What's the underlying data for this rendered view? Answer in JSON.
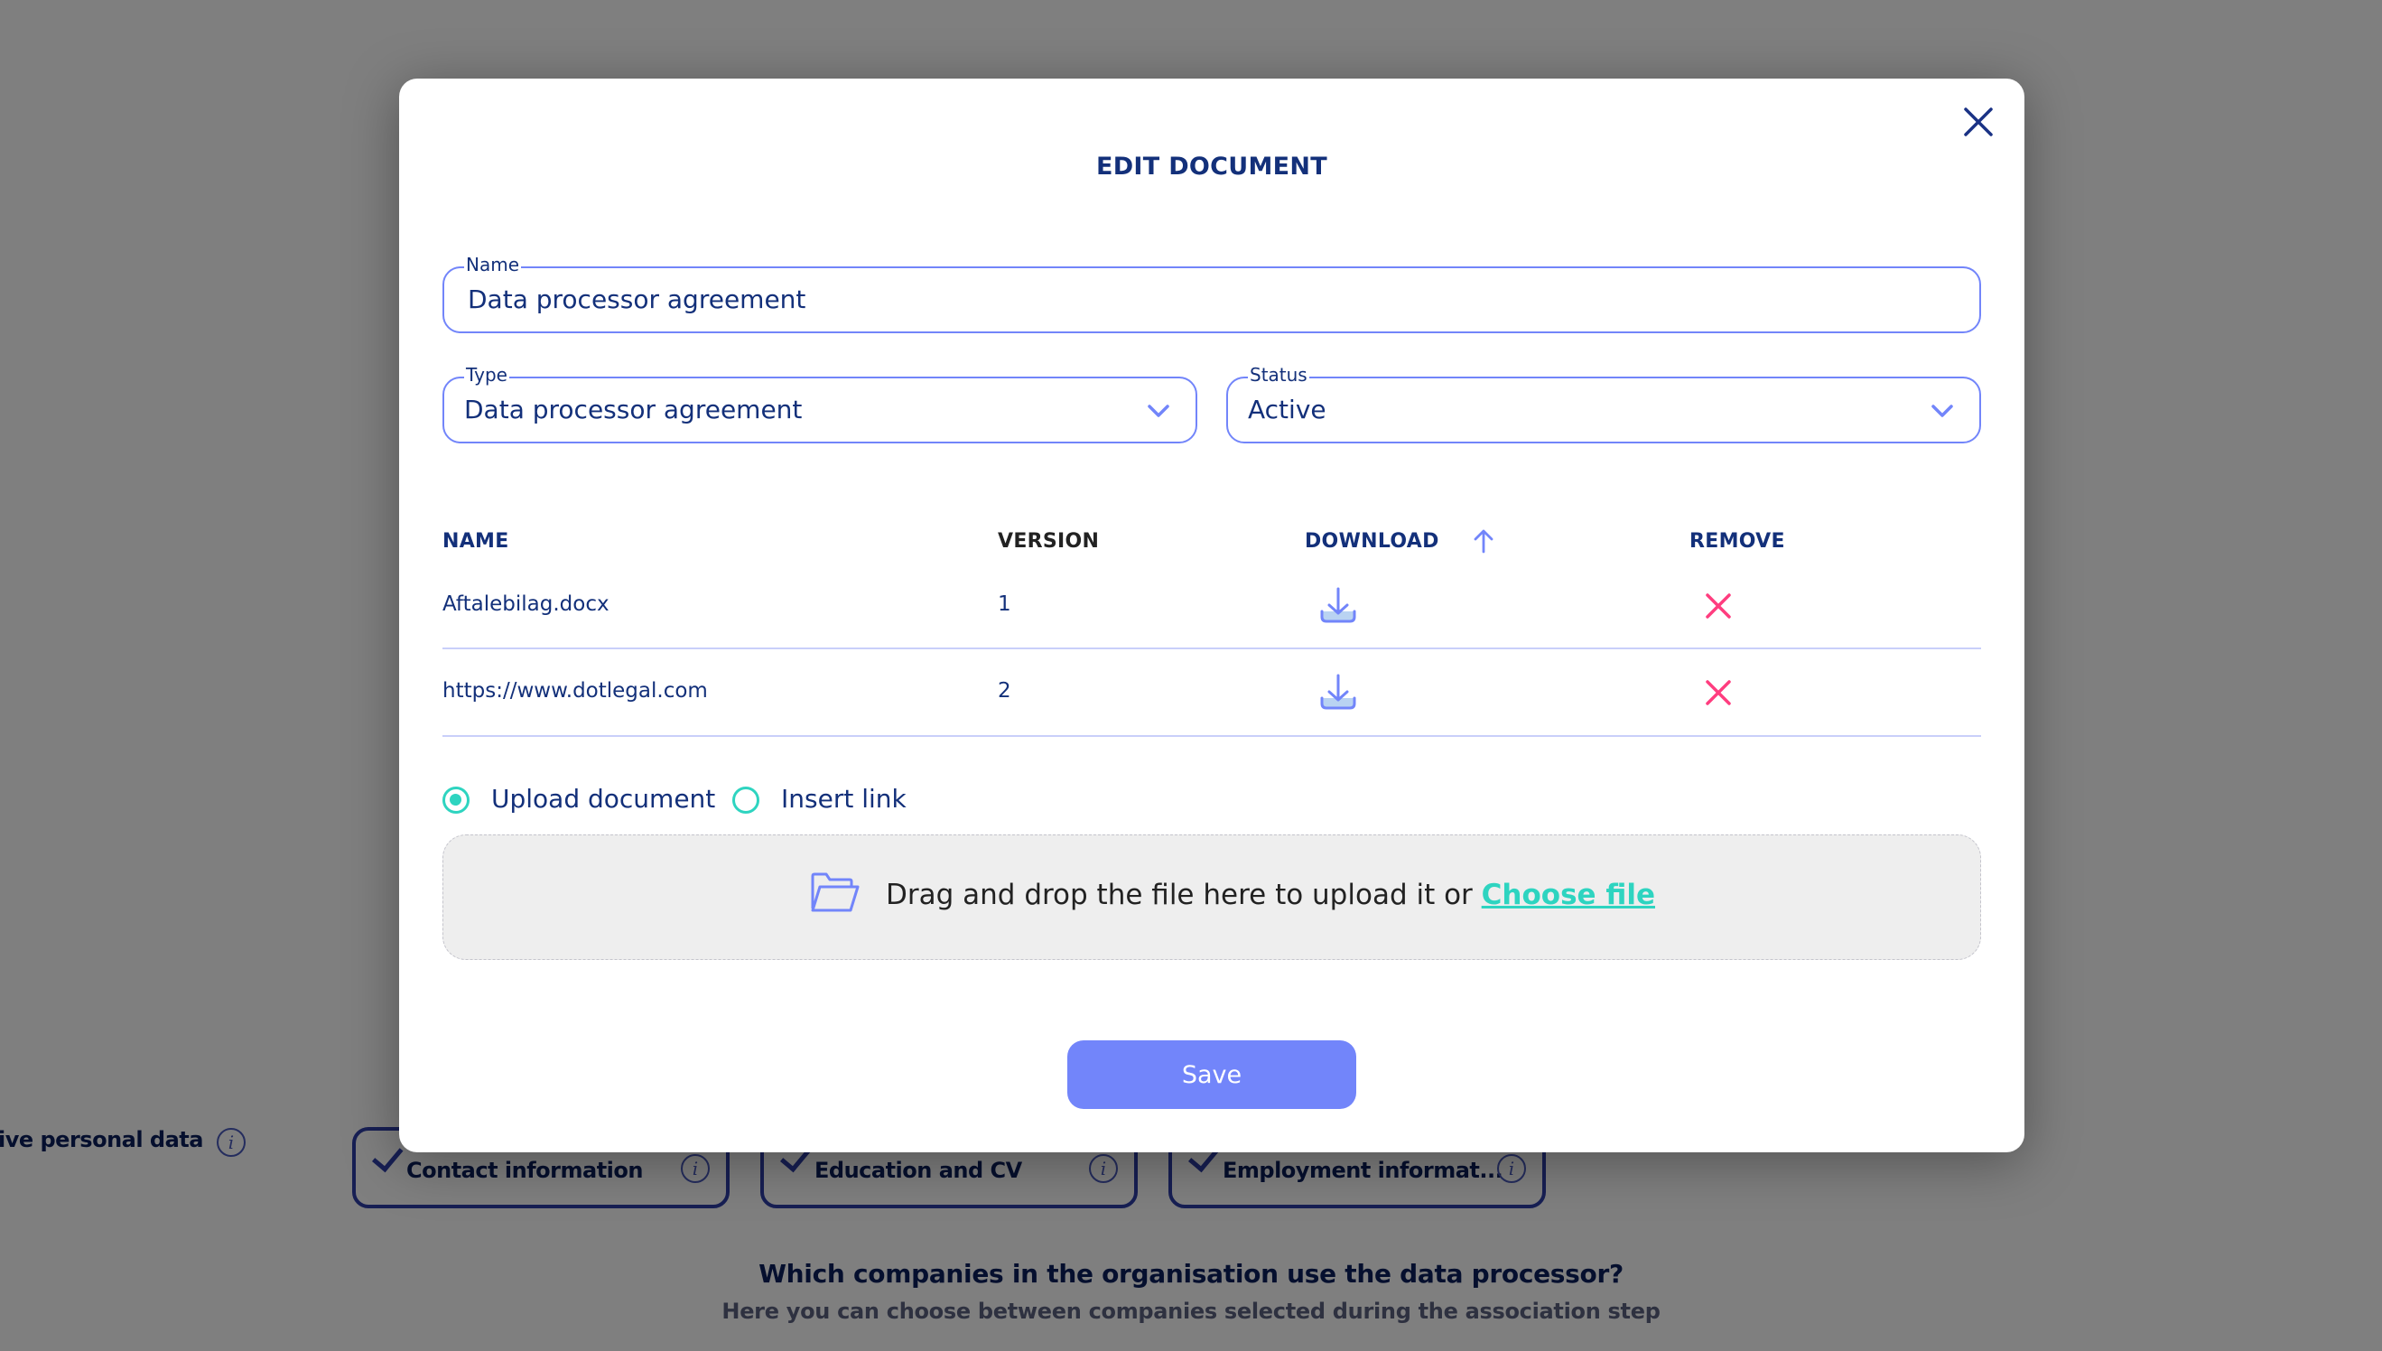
{
  "background": {
    "section_label": "ive personal data",
    "chips": [
      {
        "label": "Contact information",
        "checked": true
      },
      {
        "label": "Education and CV",
        "checked": true
      },
      {
        "label": "Employment informat...",
        "checked": true
      }
    ],
    "question": "Which companies in the organisation use the data processor?",
    "subtitle": "Here you can choose between companies selected during the association step",
    "info_glyph": "i"
  },
  "modal": {
    "title": "EDIT DOCUMENT",
    "close_icon": "close-icon",
    "name_field": {
      "label": "Name",
      "value": "Data processor agreement"
    },
    "type_field": {
      "label": "Type",
      "value": "Data processor agreement"
    },
    "status_field": {
      "label": "Status",
      "value": "Active"
    },
    "table": {
      "headers": {
        "name": "NAME",
        "version": "VERSION",
        "download": "DOWNLOAD",
        "remove": "REMOVE"
      },
      "sorted_by": "version",
      "sort_direction": "ascending",
      "rows": [
        {
          "name": "Aftalebilag.docx",
          "version": "1"
        },
        {
          "name": "https://www.dotlegal.com",
          "version": "2"
        }
      ]
    },
    "source_options": [
      {
        "label": "Upload document",
        "selected": true
      },
      {
        "label": "Insert link",
        "selected": false
      }
    ],
    "dropzone": {
      "text": "Drag and drop the file here to upload it or ",
      "link": "Choose file"
    },
    "save_label": "Save"
  },
  "colors": {
    "primary": "#7285fa",
    "navy": "#13307a",
    "accent_teal": "#2ed4c0",
    "remove_pink": "#ff3d7f",
    "overlay": "#808080"
  }
}
